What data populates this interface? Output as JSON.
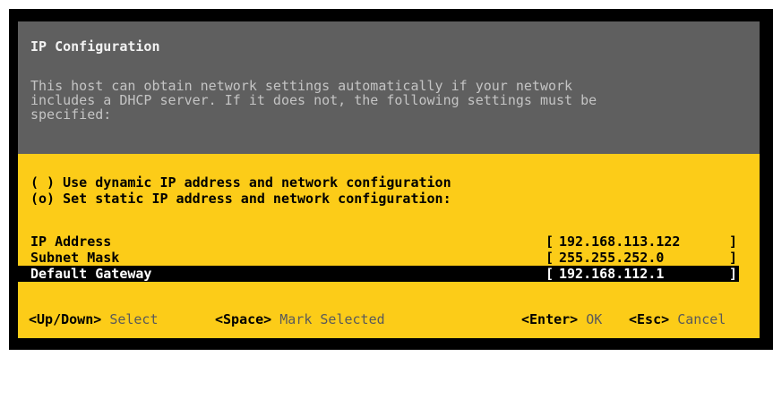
{
  "dialog": {
    "title": "IP Configuration",
    "description_lines": [
      "This host can obtain network settings automatically if your network",
      "includes a DHCP server. If it does not, the following settings must be",
      "specified:"
    ]
  },
  "options": [
    {
      "marker": "( )",
      "label": "Use dynamic IP address and network configuration",
      "selected": false
    },
    {
      "marker": "(o)",
      "label": "Set static IP address and network configuration:",
      "selected": true
    }
  ],
  "fields": [
    {
      "label": "IP Address",
      "value": "192.168.113.122",
      "focused": false
    },
    {
      "label": "Subnet Mask",
      "value": "255.255.252.0",
      "focused": false
    },
    {
      "label": "Default Gateway",
      "value": "192.168.112.1",
      "focused": true
    }
  ],
  "brackets": {
    "open": "[",
    "close": "]"
  },
  "footer": {
    "select_key": "<Up/Down>",
    "select_action": "Select",
    "mark_key": "<Space>",
    "mark_action": "Mark Selected",
    "ok_key": "<Enter>",
    "ok_action": "OK",
    "cancel_key": "<Esc>",
    "cancel_action": "Cancel"
  },
  "colors": {
    "header_bg": "#5f5f5f",
    "body_bg": "#fccc18",
    "selection_bg": "#000000",
    "selection_fg": "#ffffff"
  }
}
